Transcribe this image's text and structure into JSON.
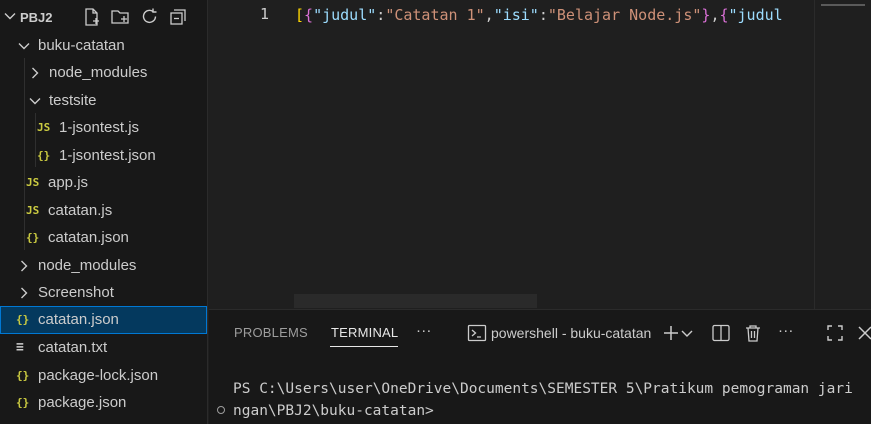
{
  "explorer": {
    "project": "PBJ2",
    "actions": [
      "new-file-icon",
      "new-folder-icon",
      "refresh-icon",
      "collapse-all-icon"
    ]
  },
  "tree": [
    {
      "label": "buku-catatan",
      "type": "folder",
      "expanded": true
    },
    {
      "label": "node_modules",
      "type": "folder",
      "expanded": false
    },
    {
      "label": "testsite",
      "type": "folder",
      "expanded": true
    },
    {
      "label": "1-jsontest.js",
      "type": "js",
      "icon": "JS"
    },
    {
      "label": "1-jsontest.json",
      "type": "json",
      "icon": "{}"
    },
    {
      "label": "app.js",
      "type": "js",
      "icon": "JS"
    },
    {
      "label": "catatan.js",
      "type": "js",
      "icon": "JS"
    },
    {
      "label": "catatan.json",
      "type": "json",
      "icon": "{}"
    },
    {
      "label": "node_modules",
      "type": "folder",
      "expanded": false
    },
    {
      "label": "Screenshot",
      "type": "folder",
      "expanded": false
    },
    {
      "label": "catatan.json",
      "type": "json",
      "icon": "{}",
      "selected": true
    },
    {
      "label": "catatan.txt",
      "type": "txt",
      "icon": "≡"
    },
    {
      "label": "package-lock.json",
      "type": "json",
      "icon": "{}"
    },
    {
      "label": "package.json",
      "type": "json",
      "icon": "{}"
    }
  ],
  "editor": {
    "line_number": "1",
    "tokens": {
      "b1": "[",
      "b2": "{",
      "k1": "\"judul\"",
      "c1": ":",
      "v1": "\"Catatan 1\"",
      "cm1": ",",
      "k2": "\"isi\"",
      "c2": ":",
      "v2": "\"Belajar Node.js\"",
      "b3": "}",
      "cm2": ",",
      "b4": "{",
      "k3": "\"judul"
    }
  },
  "panel": {
    "tabs": {
      "problems": "PROBLEMS",
      "terminal": "TERMINAL",
      "more": "···"
    },
    "terminal_name": "powershell - buku-catatan",
    "terminal_lines": [
      "PS C:\\Users\\user\\OneDrive\\Documents\\SEMESTER 5\\Pratikum pemograman jari",
      "ngan\\PBJ2\\buku-catatan>"
    ]
  },
  "colors": {
    "background": "#1f1f1f",
    "sidebar": "#181818",
    "selection": "#04395e",
    "focus_border": "#0078d4",
    "json_icon": "#cbcb41",
    "key": "#9cdcfe",
    "string": "#ce9178",
    "bracket_level1": "#ffd700",
    "bracket_level2": "#da70d6"
  }
}
